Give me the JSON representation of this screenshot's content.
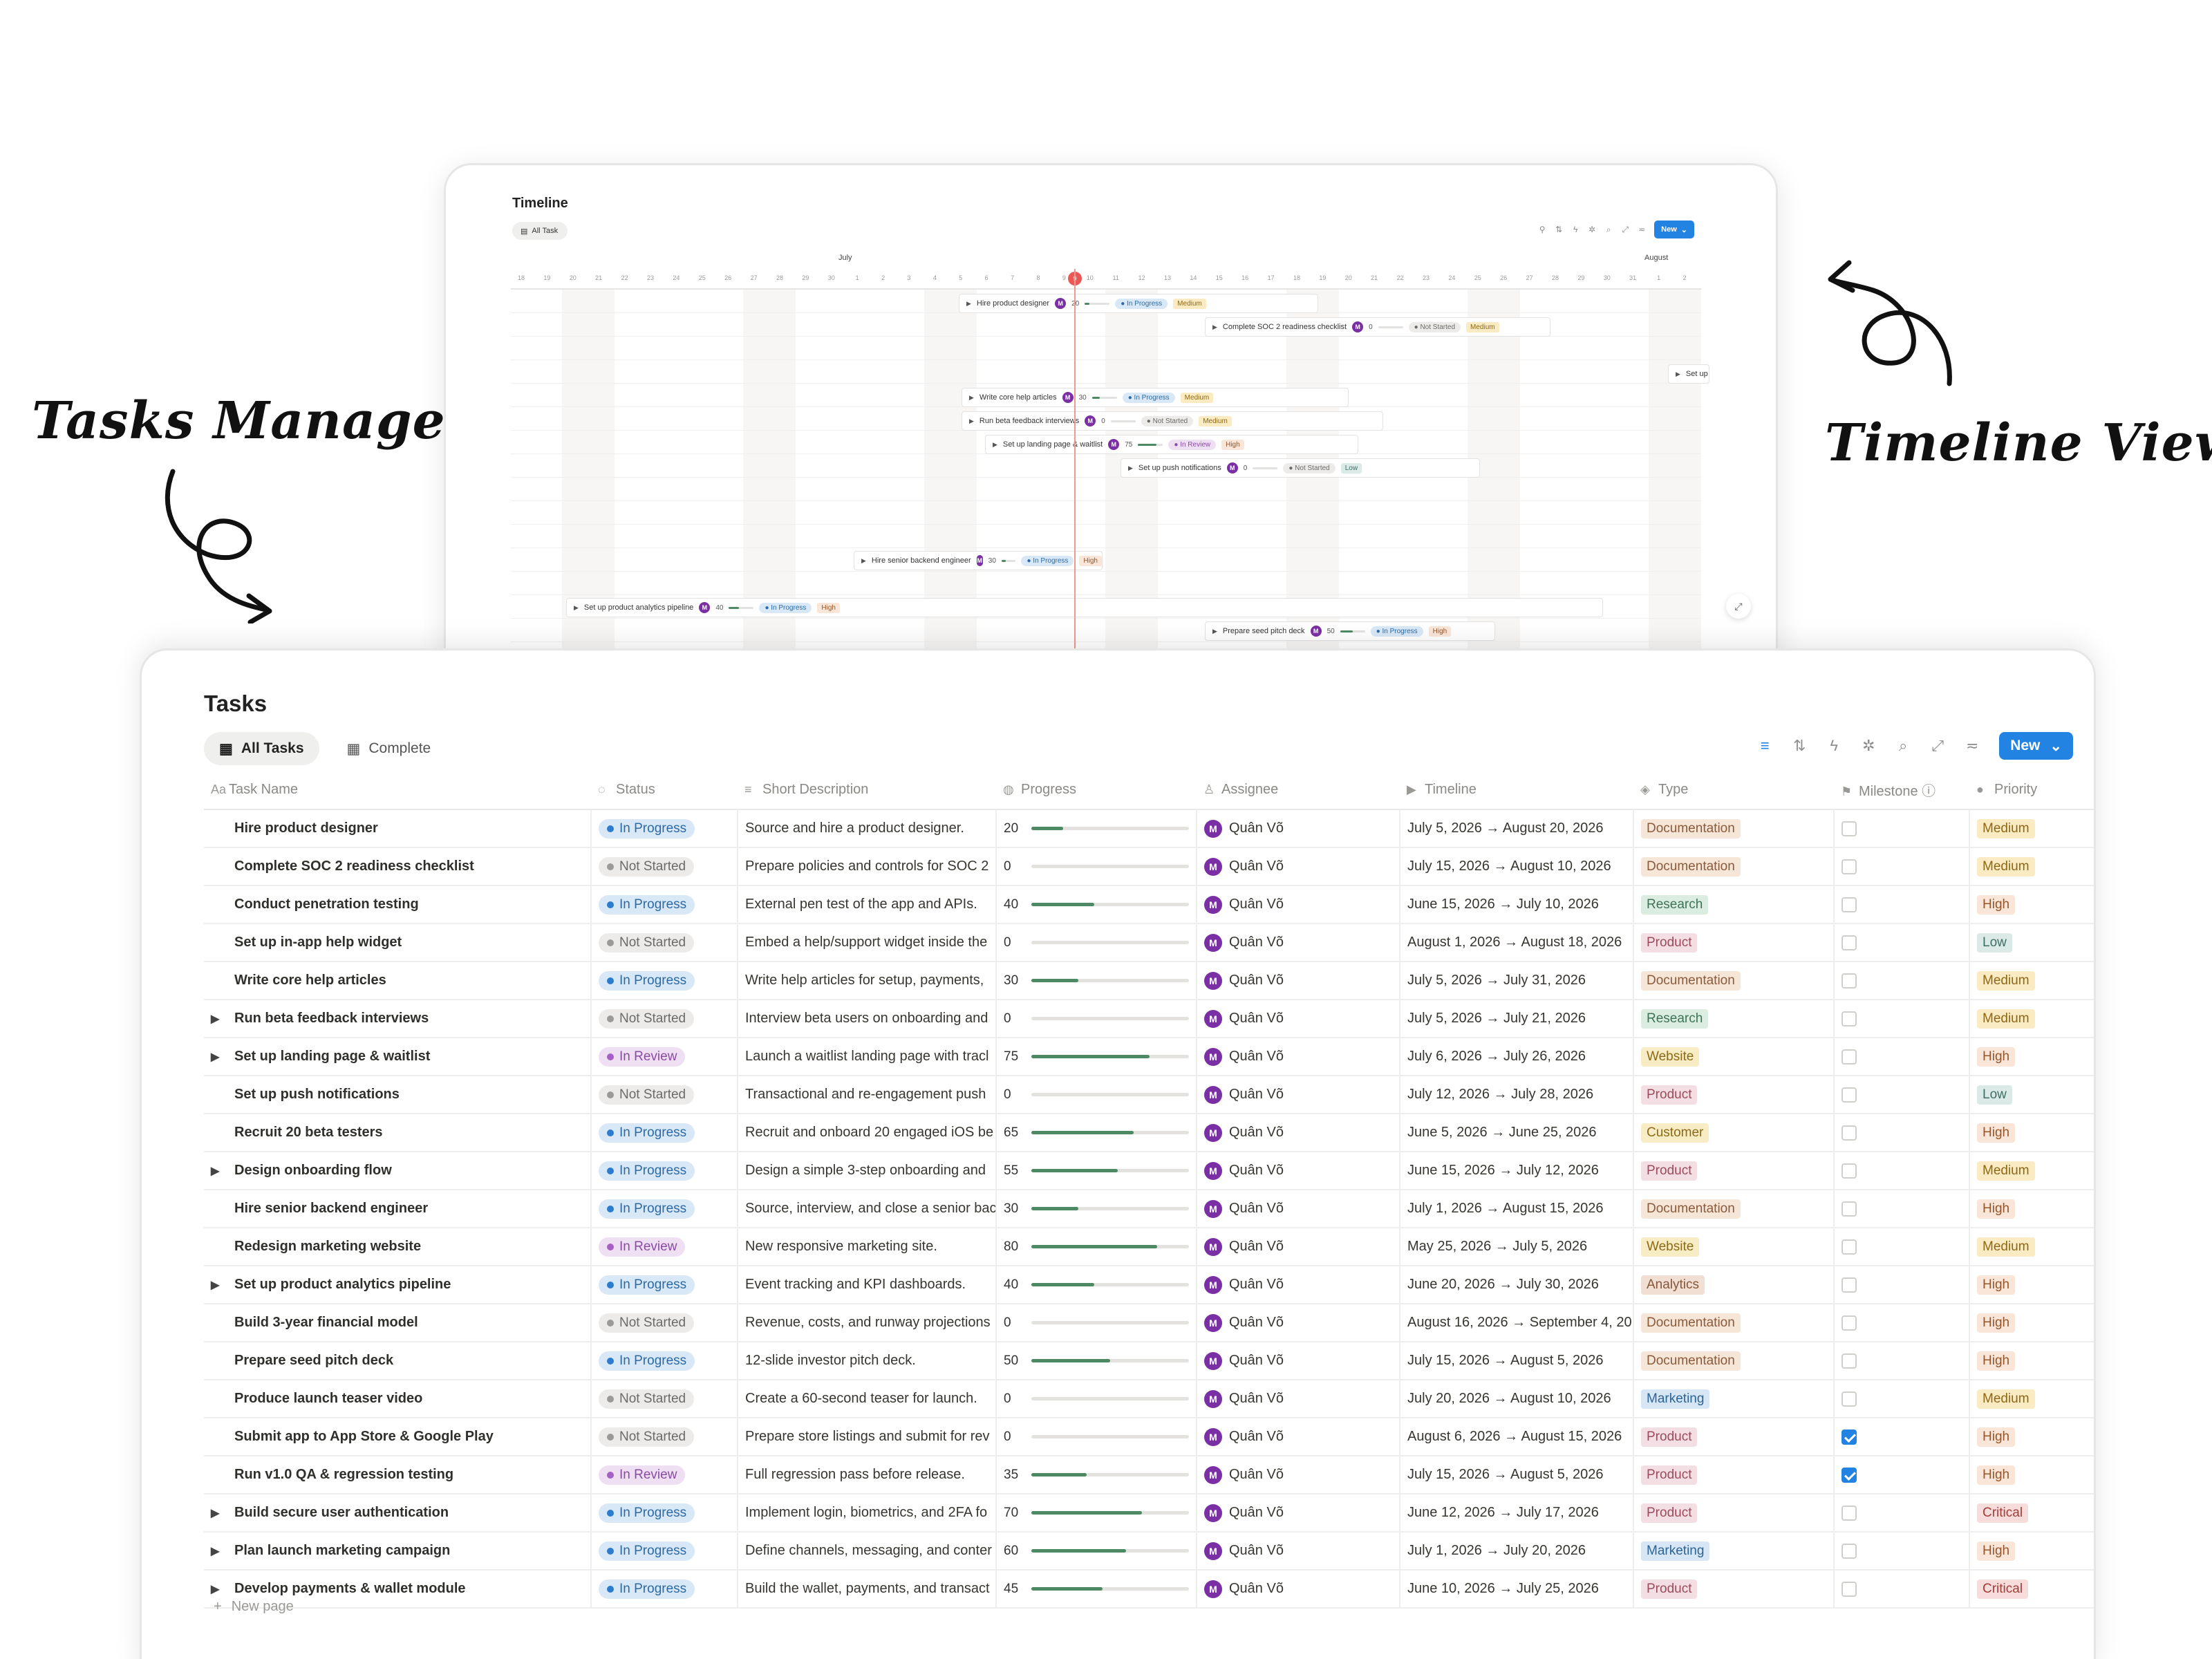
{
  "annotations": {
    "tasks_management": "Tasks Management",
    "timeline_view": "Timeline View"
  },
  "timeline": {
    "title": "Timeline",
    "tab_label": "All Task",
    "new_label": "New",
    "months": [
      "July",
      "August"
    ],
    "days": [
      "18",
      "19",
      "20",
      "21",
      "22",
      "23",
      "24",
      "25",
      "26",
      "27",
      "28",
      "29",
      "30",
      "1",
      "2",
      "3",
      "4",
      "5",
      "6",
      "7",
      "8",
      "9",
      "10",
      "11",
      "12",
      "13",
      "14",
      "15",
      "16",
      "17",
      "18",
      "19",
      "20",
      "21",
      "22",
      "23",
      "24",
      "25",
      "26",
      "27",
      "28",
      "29",
      "30",
      "31",
      "1",
      "2"
    ],
    "today": "9",
    "bars": [
      {
        "name": "Hire product designer",
        "avatar": "M",
        "progress": "20",
        "status": "In Progress",
        "status_class": "st-progress",
        "priority": "Medium",
        "priority_class": "pr-medium"
      },
      {
        "name": "Complete SOC 2 readiness checklist",
        "avatar": "M",
        "progress": "0",
        "status": "Not Started",
        "status_class": "st-not",
        "priority": "Medium",
        "priority_class": "pr-medium"
      },
      {
        "name": "Set up i",
        "avatar": "",
        "progress": "",
        "status": "",
        "status_class": "",
        "priority": "",
        "priority_class": ""
      },
      {
        "name": "Write core help articles",
        "avatar": "M",
        "progress": "30",
        "status": "In Progress",
        "status_class": "st-progress",
        "priority": "Medium",
        "priority_class": "pr-medium"
      },
      {
        "name": "Run beta feedback interviews",
        "avatar": "M",
        "progress": "0",
        "status": "Not Started",
        "status_class": "st-not",
        "priority": "Medium",
        "priority_class": "pr-medium"
      },
      {
        "name": "Set up landing page & waitlist",
        "avatar": "M",
        "progress": "75",
        "status": "In Review",
        "status_class": "st-review",
        "priority": "High",
        "priority_class": "pr-high"
      },
      {
        "name": "Set up push notifications",
        "avatar": "M",
        "progress": "0",
        "status": "Not Started",
        "status_class": "st-not",
        "priority": "Low",
        "priority_class": "pr-low"
      },
      {
        "name": "Hire senior backend engineer",
        "avatar": "M",
        "progress": "30",
        "status": "In Progress",
        "status_class": "st-progress",
        "priority": "High",
        "priority_class": "pr-high"
      },
      {
        "name": "Set up product analytics pipeline",
        "avatar": "M",
        "progress": "40",
        "status": "In Progress",
        "status_class": "st-progress",
        "priority": "High",
        "priority_class": "pr-high"
      },
      {
        "name": "Prepare seed pitch deck",
        "avatar": "M",
        "progress": "50",
        "status": "In Progress",
        "status_class": "st-progress",
        "priority": "High",
        "priority_class": "pr-high"
      }
    ]
  },
  "tasks": {
    "title": "Tasks",
    "tabs": [
      {
        "label": "All Tasks",
        "active": true
      },
      {
        "label": "Complete",
        "active": false
      }
    ],
    "new_label": "New",
    "new_page_label": "New page",
    "columns": [
      {
        "key": "name",
        "label": "Task Name",
        "icon": "Aa"
      },
      {
        "key": "status",
        "label": "Status",
        "icon": "◌"
      },
      {
        "key": "desc",
        "label": "Short Description",
        "icon": "≡"
      },
      {
        "key": "progress",
        "label": "Progress",
        "icon": "◍"
      },
      {
        "key": "assignee",
        "label": "Assignee",
        "icon": "♙"
      },
      {
        "key": "timeline",
        "label": "Timeline",
        "icon": "▶"
      },
      {
        "key": "type",
        "label": "Type",
        "icon": "◈"
      },
      {
        "key": "milestone",
        "label": "Milestone ⓘ",
        "icon": "⚑"
      },
      {
        "key": "priority",
        "label": "Priority",
        "icon": "●"
      }
    ],
    "rows": [
      {
        "expand": false,
        "name": "Hire product designer",
        "status": "In Progress",
        "desc": "Source and hire a product designer.",
        "progress": 20,
        "assignee": "Quân Võ",
        "timeline": "July 5, 2026 → August 20, 2026",
        "type": "Documentation",
        "milestone": false,
        "priority": "Medium"
      },
      {
        "expand": false,
        "name": "Complete SOC 2 readiness checklist",
        "status": "Not Started",
        "desc": "Prepare policies and controls for SOC 2",
        "progress": 0,
        "assignee": "Quân Võ",
        "timeline": "July 15, 2026 → August 10, 2026",
        "type": "Documentation",
        "milestone": false,
        "priority": "Medium"
      },
      {
        "expand": false,
        "name": "Conduct penetration testing",
        "status": "In Progress",
        "desc": "External pen test of the app and APIs.",
        "progress": 40,
        "assignee": "Quân Võ",
        "timeline": "June 15, 2026 → July 10, 2026",
        "type": "Research",
        "milestone": false,
        "priority": "High"
      },
      {
        "expand": false,
        "name": "Set up in-app help widget",
        "status": "Not Started",
        "desc": "Embed a help/support widget inside the",
        "progress": 0,
        "assignee": "Quân Võ",
        "timeline": "August 1, 2026 → August 18, 2026",
        "type": "Product",
        "milestone": false,
        "priority": "Low"
      },
      {
        "expand": false,
        "name": "Write core help articles",
        "status": "In Progress",
        "desc": "Write help articles for setup, payments,",
        "progress": 30,
        "assignee": "Quân Võ",
        "timeline": "July 5, 2026 → July 31, 2026",
        "type": "Documentation",
        "milestone": false,
        "priority": "Medium"
      },
      {
        "expand": true,
        "name": "Run beta feedback interviews",
        "status": "Not Started",
        "desc": "Interview beta users on onboarding and",
        "progress": 0,
        "assignee": "Quân Võ",
        "timeline": "July 5, 2026 → July 21, 2026",
        "type": "Research",
        "milestone": false,
        "priority": "Medium"
      },
      {
        "expand": true,
        "name": "Set up landing page & waitlist",
        "status": "In Review",
        "desc": "Launch a waitlist landing page with tracl",
        "progress": 75,
        "assignee": "Quân Võ",
        "timeline": "July 6, 2026 → July 26, 2026",
        "type": "Website",
        "milestone": false,
        "priority": "High"
      },
      {
        "expand": false,
        "name": "Set up push notifications",
        "status": "Not Started",
        "desc": "Transactional and re-engagement push",
        "progress": 0,
        "assignee": "Quân Võ",
        "timeline": "July 12, 2026 → July 28, 2026",
        "type": "Product",
        "milestone": false,
        "priority": "Low"
      },
      {
        "expand": false,
        "name": "Recruit 20 beta testers",
        "status": "In Progress",
        "desc": "Recruit and onboard 20 engaged iOS be",
        "progress": 65,
        "assignee": "Quân Võ",
        "timeline": "June 5, 2026 → June 25, 2026",
        "type": "Customer",
        "milestone": false,
        "priority": "High"
      },
      {
        "expand": true,
        "name": "Design onboarding flow",
        "status": "In Progress",
        "desc": "Design a simple 3-step onboarding and",
        "progress": 55,
        "assignee": "Quân Võ",
        "timeline": "June 15, 2026 → July 12, 2026",
        "type": "Product",
        "milestone": false,
        "priority": "Medium"
      },
      {
        "expand": false,
        "name": "Hire senior backend engineer",
        "status": "In Progress",
        "desc": "Source, interview, and close a senior bac",
        "progress": 30,
        "assignee": "Quân Võ",
        "timeline": "July 1, 2026 → August 15, 2026",
        "type": "Documentation",
        "milestone": false,
        "priority": "High"
      },
      {
        "expand": false,
        "name": "Redesign marketing website",
        "status": "In Review",
        "desc": "New responsive marketing site.",
        "progress": 80,
        "assignee": "Quân Võ",
        "timeline": "May 25, 2026 → July 5, 2026",
        "type": "Website",
        "milestone": false,
        "priority": "Medium"
      },
      {
        "expand": true,
        "name": "Set up product analytics pipeline",
        "status": "In Progress",
        "desc": "Event tracking and KPI dashboards.",
        "progress": 40,
        "assignee": "Quân Võ",
        "timeline": "June 20, 2026 → July 30, 2026",
        "type": "Analytics",
        "milestone": false,
        "priority": "High"
      },
      {
        "expand": false,
        "name": "Build 3-year financial model",
        "status": "Not Started",
        "desc": "Revenue, costs, and runway projections",
        "progress": 0,
        "assignee": "Quân Võ",
        "timeline": "August 16, 2026 → September 4, 20",
        "type": "Documentation",
        "milestone": false,
        "priority": "High"
      },
      {
        "expand": false,
        "name": "Prepare seed pitch deck",
        "status": "In Progress",
        "desc": "12-slide investor pitch deck.",
        "progress": 50,
        "assignee": "Quân Võ",
        "timeline": "July 15, 2026 → August 5, 2026",
        "type": "Documentation",
        "milestone": false,
        "priority": "High"
      },
      {
        "expand": false,
        "name": "Produce launch teaser video",
        "status": "Not Started",
        "desc": "Create a 60-second teaser for launch.",
        "progress": 0,
        "assignee": "Quân Võ",
        "timeline": "July 20, 2026 → August 10, 2026",
        "type": "Marketing",
        "milestone": false,
        "priority": "Medium"
      },
      {
        "expand": false,
        "name": "Submit app to App Store & Google Play",
        "status": "Not Started",
        "desc": "Prepare store listings and submit for rev",
        "progress": 0,
        "assignee": "Quân Võ",
        "timeline": "August 6, 2026 → August 15, 2026",
        "type": "Product",
        "milestone": true,
        "priority": "High"
      },
      {
        "expand": false,
        "name": "Run v1.0 QA & regression testing",
        "status": "In Review",
        "desc": "Full regression pass before release.",
        "progress": 35,
        "assignee": "Quân Võ",
        "timeline": "July 15, 2026 → August 5, 2026",
        "type": "Product",
        "milestone": true,
        "priority": "High"
      },
      {
        "expand": true,
        "name": "Build secure user authentication",
        "status": "In Progress",
        "desc": "Implement login, biometrics, and 2FA fo",
        "progress": 70,
        "assignee": "Quân Võ",
        "timeline": "June 12, 2026 → July 17, 2026",
        "type": "Product",
        "milestone": false,
        "priority": "Critical"
      },
      {
        "expand": true,
        "name": "Plan launch marketing campaign",
        "status": "In Progress",
        "desc": "Define channels, messaging, and conter",
        "progress": 60,
        "assignee": "Quân Võ",
        "timeline": "July 1, 2026 → July 20, 2026",
        "type": "Marketing",
        "milestone": false,
        "priority": "High"
      },
      {
        "expand": true,
        "name": "Develop payments & wallet module",
        "status": "In Progress",
        "desc": "Build the wallet, payments, and transact",
        "progress": 45,
        "assignee": "Quân Võ",
        "timeline": "June 10, 2026 → July 25, 2026",
        "type": "Product",
        "milestone": false,
        "priority": "Critical"
      }
    ]
  },
  "colors": {
    "accent": "#2383e2",
    "progress_fill": "#4d8a63",
    "avatar": "#7b2fa5",
    "today_marker": "#eb5757"
  }
}
